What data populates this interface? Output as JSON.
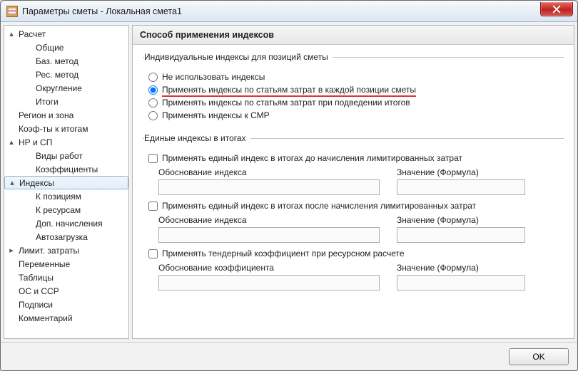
{
  "window": {
    "title": "Параметры сметы - Локальная смета1"
  },
  "tree": [
    {
      "indent": 0,
      "toggle": "▴",
      "label": "Расчет"
    },
    {
      "indent": 1,
      "label": "Общие"
    },
    {
      "indent": 1,
      "label": "Баз. метод"
    },
    {
      "indent": 1,
      "label": "Рес. метод"
    },
    {
      "indent": 1,
      "label": "Округление"
    },
    {
      "indent": 1,
      "label": "Итоги"
    },
    {
      "indent": 0,
      "label": "Регион и зона"
    },
    {
      "indent": 0,
      "label": "Коэф-ты к итогам"
    },
    {
      "indent": 0,
      "toggle": "▴",
      "label": "НР и СП"
    },
    {
      "indent": 1,
      "label": "Виды работ"
    },
    {
      "indent": 1,
      "label": "Коэффициенты"
    },
    {
      "indent": 0,
      "toggle": "▴",
      "label": "Индексы",
      "selected": true
    },
    {
      "indent": 1,
      "label": "К позициям"
    },
    {
      "indent": 1,
      "label": "К ресурсам"
    },
    {
      "indent": 1,
      "label": "Доп. начисления"
    },
    {
      "indent": 1,
      "label": "Автозагрузка"
    },
    {
      "indent": 0,
      "toggle": "▸",
      "label": "Лимит. затраты"
    },
    {
      "indent": 0,
      "label": "Переменные"
    },
    {
      "indent": 0,
      "label": "Таблицы"
    },
    {
      "indent": 0,
      "label": "ОС и ССР"
    },
    {
      "indent": 0,
      "label": "Подписи"
    },
    {
      "indent": 0,
      "label": "Комментарий"
    }
  ],
  "main": {
    "header": "Способ применения индексов",
    "group1": {
      "legend": "Индивидуальные индексы для позиций сметы",
      "options": [
        "Не использовать индексы",
        "Применять индексы по статьям затрат в каждой позиции сметы",
        "Применять индексы по статьям затрат при подведении итогов",
        "Применять индексы к СМР"
      ],
      "selected": 1
    },
    "group2": {
      "legend": "Единые индексы в итогах",
      "blocks": [
        {
          "check": "Применять единый индекс в итогах до начисления лимитированных затрат",
          "field1_label": "Обоснование индекса",
          "field2_label": "Значение (Формула)",
          "field1_value": "",
          "field2_value": ""
        },
        {
          "check": "Применять единый индекс в итогах после начисления лимитированных затрат",
          "field1_label": "Обоснование индекса",
          "field2_label": "Значение (Формула)",
          "field1_value": "",
          "field2_value": ""
        },
        {
          "check": "Применять тендерный коэффициент при ресурсном расчете",
          "field1_label": "Обоснование коэффициента",
          "field2_label": "Значение (Формула)",
          "field1_value": "",
          "field2_value": ""
        }
      ]
    }
  },
  "footer": {
    "ok": "OK"
  }
}
